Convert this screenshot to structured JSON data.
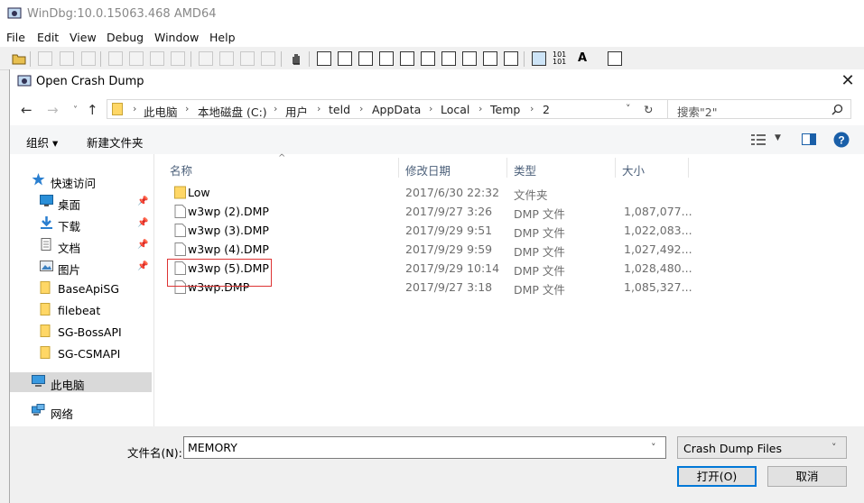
{
  "app": {
    "title": "WinDbg:10.0.15063.468 AMD64"
  },
  "menu": [
    "File",
    "Edit",
    "View",
    "Debug",
    "Window",
    "Help"
  ],
  "dialog": {
    "title": "Open Crash Dump",
    "close_glyph": "✕",
    "breadcrumb": [
      "此电脑",
      "本地磁盘 (C:)",
      "用户",
      "teld",
      "AppData",
      "Local",
      "Temp",
      "2"
    ],
    "search_placeholder": "搜索\"2\"",
    "organize_label": "组织 ▾",
    "new_folder_label": "新建文件夹",
    "nav": [
      {
        "label": "快速访问",
        "icon": "star-icon"
      },
      {
        "label": "桌面",
        "icon": "desktop-icon",
        "pinned": true
      },
      {
        "label": "下载",
        "icon": "download-icon",
        "pinned": true
      },
      {
        "label": "文档",
        "icon": "document-icon",
        "pinned": true
      },
      {
        "label": "图片",
        "icon": "pictures-icon",
        "pinned": true
      },
      {
        "label": "BaseApiSG",
        "icon": "folder-icon"
      },
      {
        "label": "filebeat",
        "icon": "folder-icon"
      },
      {
        "label": "SG-BossAPI",
        "icon": "folder-icon"
      },
      {
        "label": "SG-CSMAPI",
        "icon": "folder-icon"
      },
      {
        "label": "此电脑",
        "icon": "computer-icon",
        "selected": true
      },
      {
        "label": "网络",
        "icon": "network-icon"
      }
    ],
    "columns": [
      "名称",
      "修改日期",
      "类型",
      "大小"
    ],
    "files": [
      {
        "name": "Low",
        "date": "2017/6/30 22:32",
        "type": "文件夹",
        "size": "",
        "icon": "folder-icon"
      },
      {
        "name": "w3wp (2).DMP",
        "date": "2017/9/27 3:26",
        "type": "DMP 文件",
        "size": "1,087,077...",
        "icon": "file-icon"
      },
      {
        "name": "w3wp (3).DMP",
        "date": "2017/9/29 9:51",
        "type": "DMP 文件",
        "size": "1,022,083...",
        "icon": "file-icon"
      },
      {
        "name": "w3wp (4).DMP",
        "date": "2017/9/29 9:59",
        "type": "DMP 文件",
        "size": "1,027,492...",
        "icon": "file-icon"
      },
      {
        "name": "w3wp (5).DMP",
        "date": "2017/9/29 10:14",
        "type": "DMP 文件",
        "size": "1,028,480...",
        "icon": "file-icon"
      },
      {
        "name": "w3wp.DMP",
        "date": "2017/9/27 3:18",
        "type": "DMP 文件",
        "size": "1,085,327...",
        "icon": "file-icon"
      }
    ],
    "filename_label": "文件名(N):",
    "filename_value": "MEMORY",
    "filter_value": "Crash Dump Files",
    "open_label": "打开(O)",
    "cancel_label": "取消"
  },
  "colors": {
    "accent": "#0078d7",
    "folder": "#ffd766",
    "highlight": "#dd3333",
    "selected_bg": "#d9d9d9"
  }
}
